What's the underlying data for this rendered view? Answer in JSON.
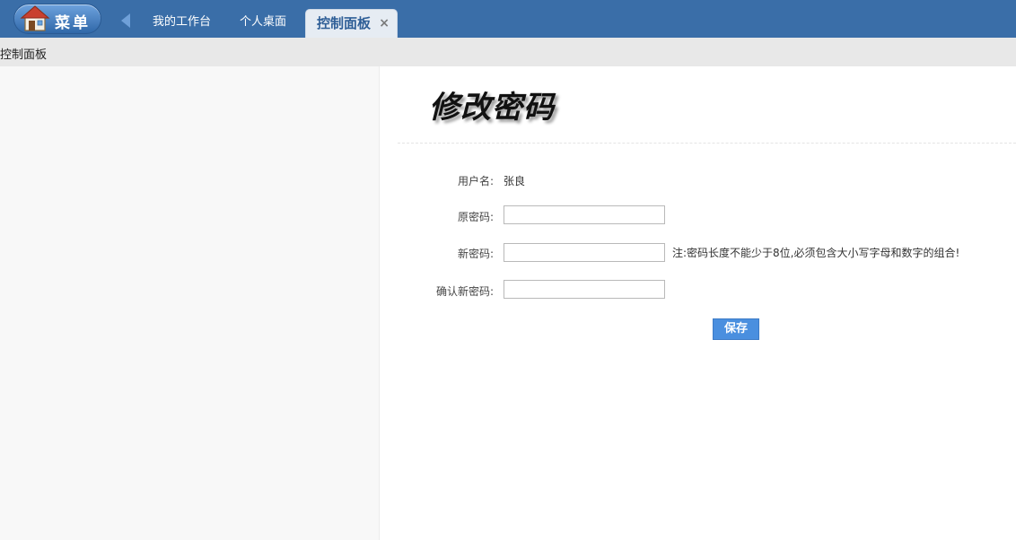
{
  "topbar": {
    "menu_label": "菜单",
    "tabs": [
      {
        "label": "我的工作台"
      },
      {
        "label": "个人桌面"
      },
      {
        "label": "控制面板",
        "close": "×"
      }
    ]
  },
  "breadcrumb": {
    "text": "控制面板"
  },
  "form": {
    "title": "修改密码",
    "username_label": "用户名:",
    "username_value": "张良",
    "old_password_label": "原密码:",
    "new_password_label": "新密码:",
    "confirm_password_label": "确认新密码:",
    "note": "注:密码长度不能少于8位,必须包含大小写字母和数字的组合!",
    "save_label": "保存"
  },
  "icons": {
    "menu": "house-icon",
    "back": "arrow-left-icon",
    "close": "close-icon"
  },
  "colors": {
    "topbar": "#3a6ea8",
    "save_button": "#4a8fdf",
    "active_tab_text": "#2f5f97"
  }
}
